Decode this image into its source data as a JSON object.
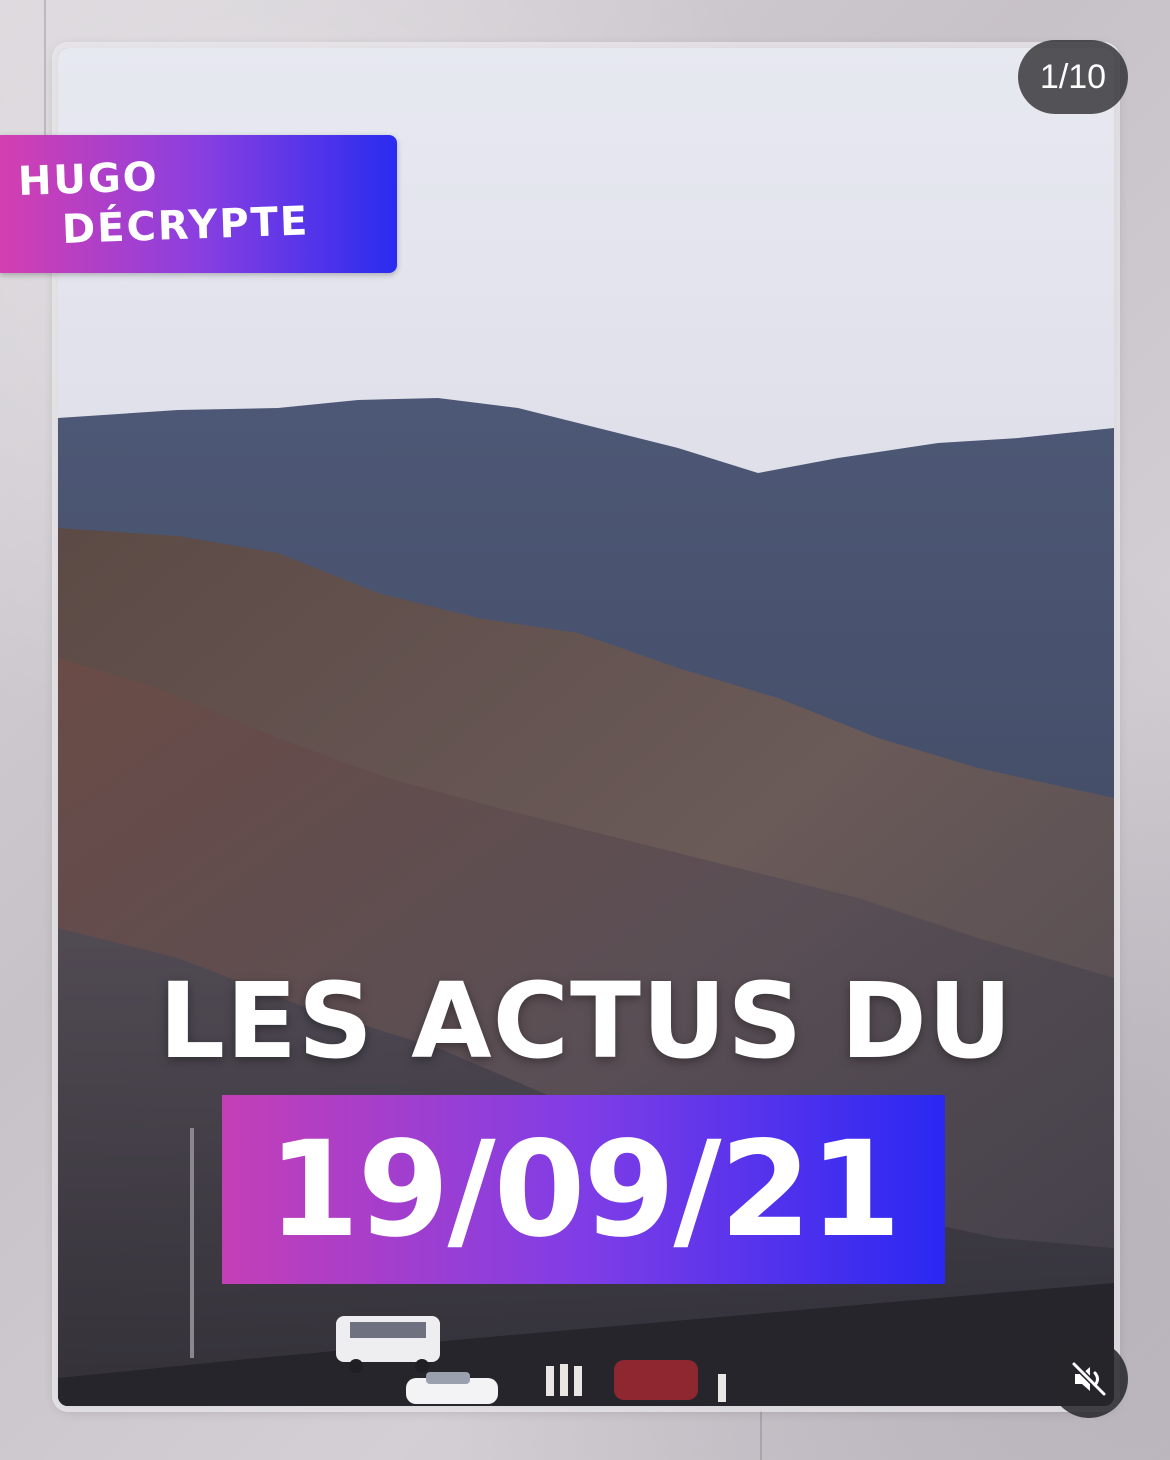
{
  "story": {
    "counter": "1/10",
    "brand": {
      "line1": "HUGO",
      "line2": "DÉCRYPTE"
    },
    "headline": "LES ACTUS DU",
    "date": "19/09/21",
    "mute_icon": "speaker-muted-icon"
  },
  "colors": {
    "brand_gradient_start": "#d43fb0",
    "brand_gradient_end": "#2a2cf0",
    "date_gradient_start": "#c43fb6",
    "date_gradient_end": "#2a28f2"
  }
}
